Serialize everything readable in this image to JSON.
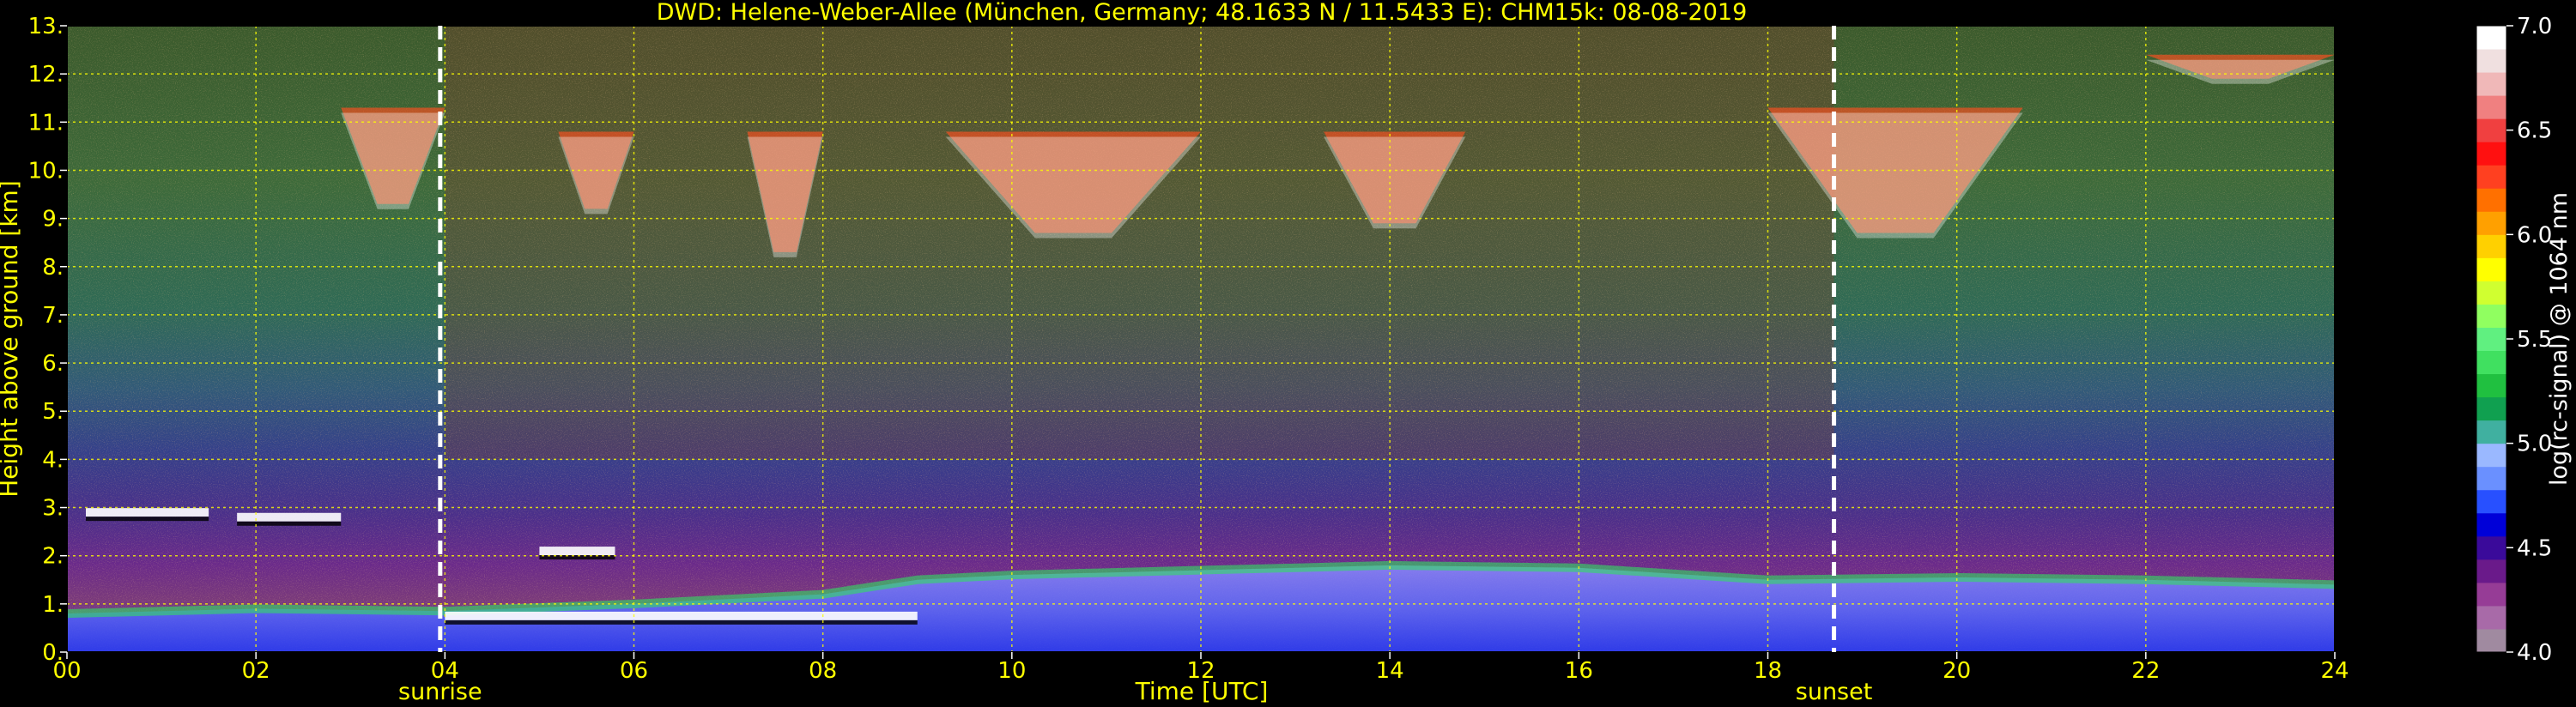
{
  "chart_data": {
    "type": "heatmap",
    "title": "DWD: Helene-Weber-Allee (München, Germany; 48.1633 N / 11.5433 E):    CHM15k: 08-08-2019",
    "xlabel": "Time [UTC]",
    "ylabel": "Height above ground [km]",
    "xlim": [
      0,
      24
    ],
    "ylim": [
      0,
      13
    ],
    "x_ticks": [
      0,
      2,
      4,
      6,
      8,
      10,
      12,
      14,
      16,
      18,
      20,
      22,
      24
    ],
    "x_tick_labels": [
      "00",
      "02",
      "04",
      "06",
      "08",
      "10",
      "12",
      "14",
      "16",
      "18",
      "20",
      "22",
      "24"
    ],
    "y_ticks": [
      0,
      1,
      2,
      3,
      4,
      5,
      6,
      7,
      8,
      9,
      10,
      11,
      12,
      13
    ],
    "y_tick_labels": [
      "0.",
      "1.",
      "2.",
      "3.",
      "4.",
      "5.",
      "6.",
      "7.",
      "8.",
      "9.",
      "10.",
      "11.",
      "12.",
      "13."
    ],
    "grid": true,
    "grid_color": "#ffff00",
    "events": [
      {
        "label": "sunrise",
        "x": 3.95
      },
      {
        "label": "sunset",
        "x": 18.7
      }
    ],
    "colorbar": {
      "label": "log(rc-signal) @ 1064 nm",
      "range": [
        4.0,
        7.0
      ],
      "ticks": [
        4.0,
        4.5,
        5.0,
        5.5,
        6.0,
        6.5,
        7.0
      ],
      "tick_labels": [
        "4.0",
        "4.5",
        "5.0",
        "5.5",
        "6.0",
        "6.5",
        "7.0"
      ],
      "colors": [
        "#a08aa0",
        "#a86aa8",
        "#963c96",
        "#6a1a8a",
        "#3a0a9a",
        "#0000d8",
        "#2850ff",
        "#6a90ff",
        "#9ab8ff",
        "#40b0a0",
        "#10a050",
        "#20c040",
        "#40e060",
        "#60f080",
        "#90ff60",
        "#d0ff30",
        "#ffff00",
        "#ffd000",
        "#ffa000",
        "#ff7000",
        "#ff4020",
        "#ff1010",
        "#f04040",
        "#f08080",
        "#f0b8b8",
        "#f0e0e0",
        "#ffffff"
      ]
    },
    "features": {
      "boundary_layer": [
        [
          0,
          0.8
        ],
        [
          2,
          0.9
        ],
        [
          4,
          0.85
        ],
        [
          6,
          1.0
        ],
        [
          8,
          1.2
        ],
        [
          9,
          1.5
        ],
        [
          10,
          1.6
        ],
        [
          12,
          1.7
        ],
        [
          14,
          1.8
        ],
        [
          16,
          1.75
        ],
        [
          18,
          1.5
        ],
        [
          20,
          1.55
        ],
        [
          22,
          1.5
        ],
        [
          24,
          1.4
        ]
      ],
      "low_clouds": [
        {
          "x0": 0.2,
          "x1": 1.5,
          "y": 2.9
        },
        {
          "x0": 1.8,
          "x1": 2.9,
          "y": 2.8
        },
        {
          "x0": 5.0,
          "x1": 5.8,
          "y": 2.1
        },
        {
          "x0": 4.0,
          "x1": 9.0,
          "y": 0.75
        }
      ],
      "cirrus": [
        {
          "x0": 2.9,
          "x1": 4.0,
          "ytop": 11.3,
          "ybot": 9.3
        },
        {
          "x0": 5.2,
          "x1": 6.0,
          "ytop": 10.8,
          "ybot": 9.2
        },
        {
          "x0": 7.2,
          "x1": 8.0,
          "ytop": 10.8,
          "ybot": 8.3
        },
        {
          "x0": 9.3,
          "x1": 12.0,
          "ytop": 10.8,
          "ybot": 8.7
        },
        {
          "x0": 13.3,
          "x1": 14.8,
          "ytop": 10.8,
          "ybot": 8.9
        },
        {
          "x0": 18.0,
          "x1": 20.7,
          "ytop": 11.3,
          "ybot": 8.7
        },
        {
          "x0": 22.0,
          "x1": 24.0,
          "ytop": 12.4,
          "ybot": 11.9
        }
      ]
    }
  }
}
